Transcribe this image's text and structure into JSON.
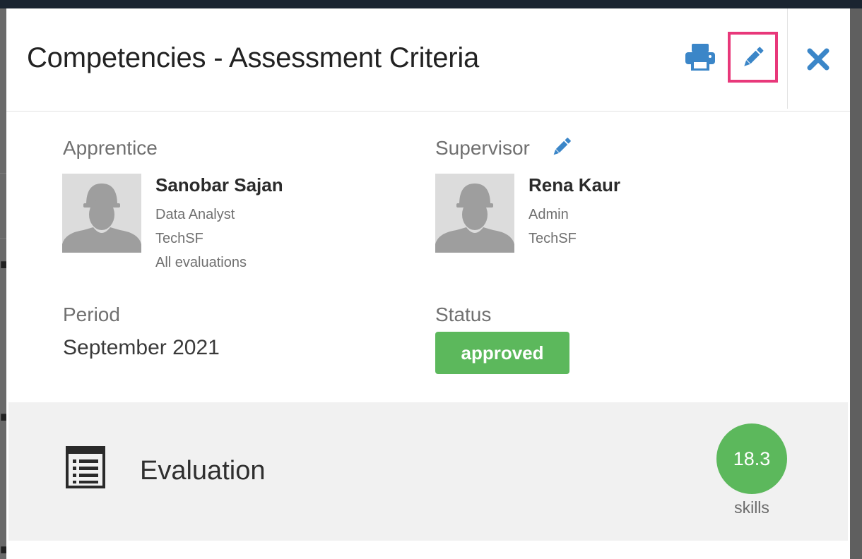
{
  "modal": {
    "title": "Competencies - Assessment Criteria",
    "print_icon": "print-icon",
    "edit_icon": "pencil-icon",
    "close_icon": "close-icon"
  },
  "apprentice": {
    "label": "Apprentice",
    "name": "Sanobar Sajan",
    "role": "Data Analyst",
    "company": "TechSF",
    "link": "All evaluations"
  },
  "supervisor": {
    "label": "Supervisor",
    "edit_icon": "pencil-icon",
    "name": "Rena Kaur",
    "role": "Admin",
    "company": "TechSF"
  },
  "period": {
    "label": "Period",
    "value": "September 2021"
  },
  "status": {
    "label": "Status",
    "value": "approved",
    "color": "#5cb85c"
  },
  "evaluation": {
    "icon": "list-icon",
    "title": "Evaluation",
    "score": "18.3",
    "score_label": "skills"
  },
  "colors": {
    "accent": "#3b86c8",
    "highlight": "#e8387a",
    "success": "#5cb85c"
  }
}
